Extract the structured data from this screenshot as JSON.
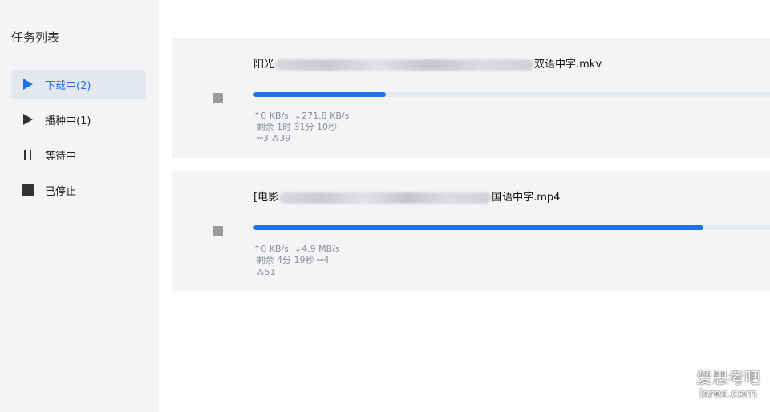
{
  "sidebar": {
    "title": "任务列表",
    "items": [
      {
        "label": "下载中",
        "count": "(2)",
        "icon": "play-icon",
        "active": true
      },
      {
        "label": "播种中",
        "count": "(1)",
        "icon": "play-icon",
        "active": false
      },
      {
        "label": "等待中",
        "count": "",
        "icon": "pause-icon",
        "active": false
      },
      {
        "label": "已停止",
        "count": "",
        "icon": "stop-icon",
        "active": false
      }
    ]
  },
  "tasks": [
    {
      "name_prefix": "阳光",
      "name_suffix": "双语中字.mkv",
      "progress": 0.25,
      "upload_speed": "0 KB/s",
      "download_speed": "271.8 KB/s",
      "remaining": "剩余 1时 31分 10秒",
      "connections": "3",
      "seeders": "39"
    },
    {
      "name_prefix": "[电影",
      "name_suffix": "国语中字.mp4",
      "progress": 0.85,
      "upload_speed": "0 KB/s",
      "download_speed": "4.9 MB/s",
      "remaining": "剩余 4分 19秒",
      "connections": "4",
      "seeders": "51"
    }
  ],
  "colors": {
    "accent": "#1a73e8",
    "sidebar_bg": "#f3f4f6",
    "card_bg": "#f3f4f6"
  },
  "watermark": {
    "line1": "爱思考吧",
    "line2": "isres.com"
  }
}
